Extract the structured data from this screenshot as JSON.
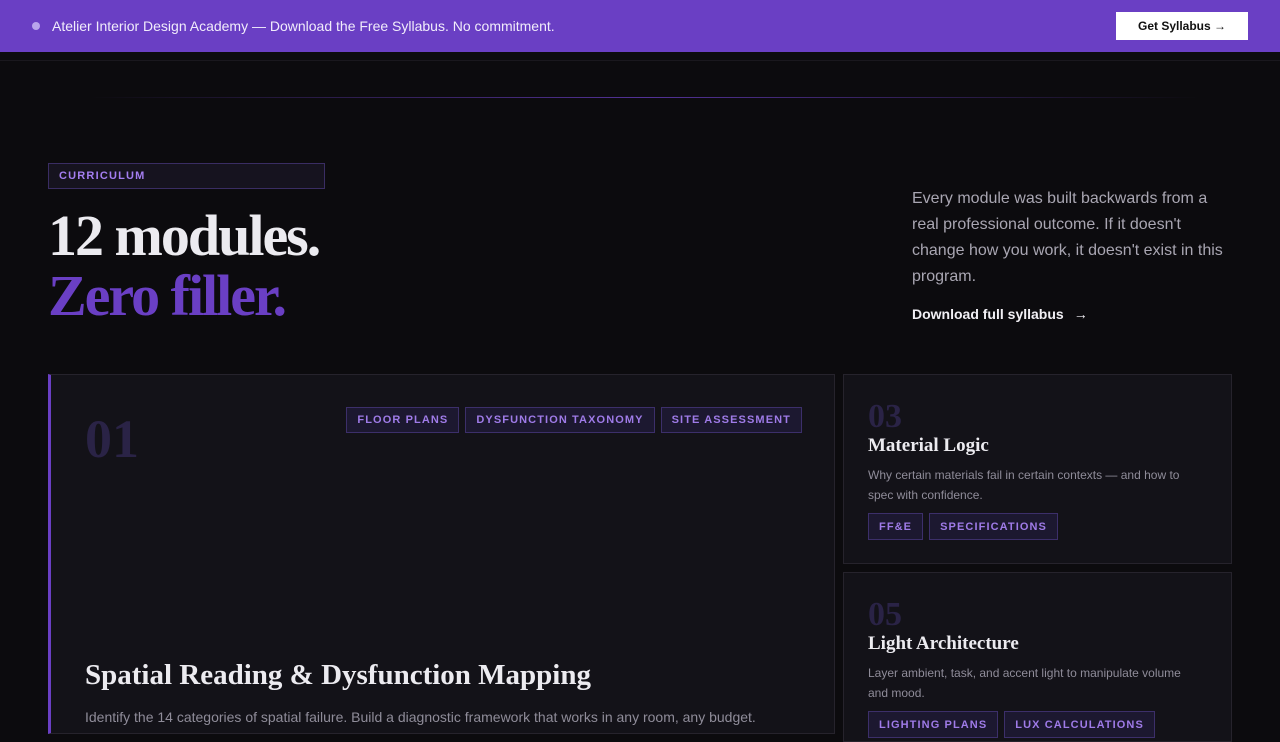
{
  "banner": {
    "message": "Atelier Interior Design Academy — Download the Free Syllabus. No commitment.",
    "cta_label": "Get Syllabus →"
  },
  "hero": {
    "eyebrow": "CURRICULUM",
    "headline_line1": "12 modules.",
    "headline_line2": "Zero filler.",
    "intro": "Every module was built backwards from a real professional outcome. If it doesn't change how you work, it doesn't exist in this program.",
    "download_label": "Download full syllabus",
    "download_arrow": "→"
  },
  "modules": [
    {
      "number": "01",
      "tags": [
        "FLOOR PLANS",
        "DYSFUNCTION TAXONOMY",
        "SITE ASSESSMENT"
      ],
      "title": "Spatial Reading & Dysfunction Mapping",
      "description": "Identify the 14 categories of spatial failure. Build a diagnostic framework that works in any room, any budget."
    },
    {
      "number": "03",
      "tags": [
        "FF&E",
        "SPECIFICATIONS"
      ],
      "title": "Material Logic",
      "description": "Why certain materials fail in certain contexts — and how to spec with confidence."
    },
    {
      "number": "05",
      "tags": [
        "LIGHTING PLANS",
        "LUX CALCULATIONS"
      ],
      "title": "Light Architecture",
      "description": "Layer ambient, task, and accent light to manipulate volume and mood."
    }
  ],
  "colors": {
    "accent": "#6a3fc4",
    "background": "#0c0b0e",
    "card": "#131218"
  }
}
